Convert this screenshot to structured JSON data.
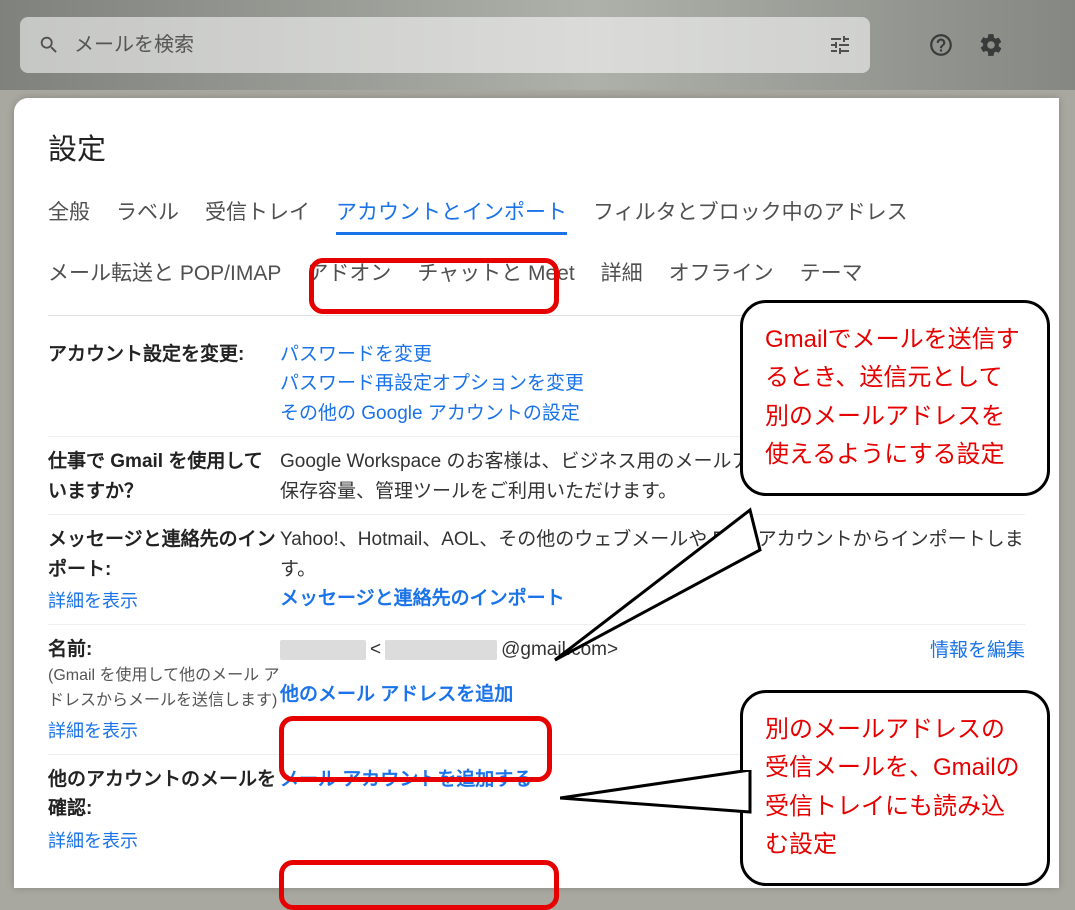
{
  "topbar": {
    "search_placeholder": "メールを検索"
  },
  "panel": {
    "title": "設定",
    "tabs": [
      "全般",
      "ラベル",
      "受信トレイ",
      "アカウントとインポート",
      "フィルタとブロック中のアドレス",
      "メール転送と POP/IMAP",
      "アドオン",
      "チャットと Meet",
      "詳細",
      "オフライン",
      "テーマ"
    ],
    "active_tab_index": 3
  },
  "rows": {
    "account_settings": {
      "label": "アカウント設定を変更:",
      "links": [
        "パスワードを変更",
        "パスワード再設定オプションを変更",
        "その他の Google アカウントの設定"
      ]
    },
    "workspace": {
      "label": "仕事で Gmail を使用していますか？",
      "text": "Google Workspace のお客様は、ビジネス用のメールアドレス（[会社名].com）、十分な保存容量、管理ツールをご利用いただけます。"
    },
    "import": {
      "label": "メッセージと連絡先のインポート:",
      "more": "詳細を表示",
      "text": "Yahoo!、Hotmail、AOL、その他のウェブメールや POP アカウントからインポートします。",
      "link": "メッセージと連絡先のインポート"
    },
    "name": {
      "label": "名前:",
      "sublabel": "(Gmail を使用して他のメール アドレスからメールを送信します)",
      "more": "詳細を表示",
      "email_prefix": "<",
      "email_domain": "@gmail.com>",
      "add_link": "他のメール アドレスを追加",
      "edit_link": "情報を編集"
    },
    "other_accounts": {
      "label": "他のアカウントのメールを確認:",
      "more": "詳細を表示",
      "add_link": "メール アカウントを追加する"
    }
  },
  "callouts": {
    "c1": "Gmailでメールを送信するとき、送信元として別のメールアドレスを使えるようにする設定",
    "c2": "別のメールアドレスの受信メールを、Gmailの受信トレイにも読み込む設定"
  }
}
